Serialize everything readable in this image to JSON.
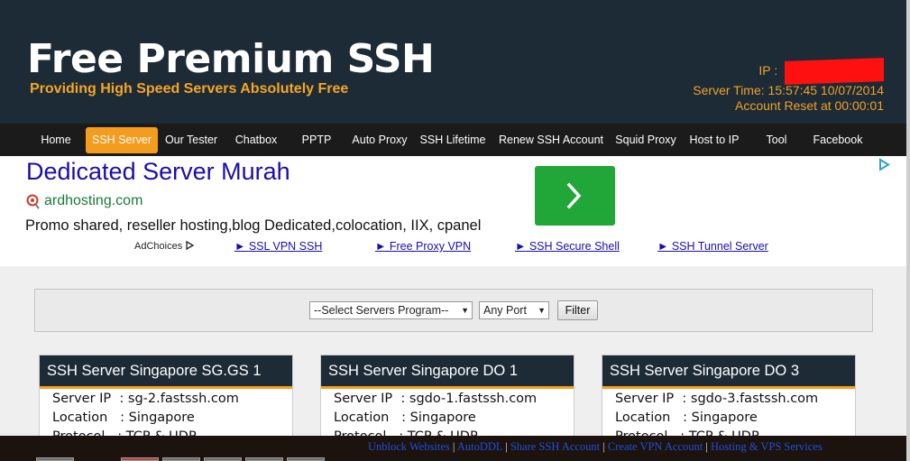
{
  "header": {
    "title": "Free Premium SSH",
    "subtitle": "Providing High Speed Servers Absolutely Free",
    "ip_label": "IP : ",
    "server_time": "Server Time: 15:57:45 10/07/2014",
    "account_reset": "Account Reset at 00:00:01"
  },
  "nav": {
    "active": "SSH Server",
    "items": [
      "Home",
      "SSH Server",
      "Our Tester",
      "Chatbox",
      "PPTP",
      "Auto Proxy",
      "SSH Lifetime",
      "Renew SSH Account",
      "Squid Proxy",
      "Host to IP",
      "Tool",
      "Facebook"
    ]
  },
  "ad": {
    "title": "Dedicated Server Murah",
    "url": "ardhosting.com",
    "description": "Promo shared, reseller hosting,blog Dedicated,colocation, IIX, cpanel",
    "adchoices": "AdChoices",
    "links": [
      "► SSL VPN SSH",
      "► Free Proxy VPN",
      "► SSH Secure Shell",
      "► SSH Tunnel Server"
    ],
    "button_color": "#21a638"
  },
  "filter": {
    "program_select": "--Select Servers Program--",
    "port_select": "Any Port",
    "button": "Filter"
  },
  "servers": [
    {
      "title": "SSH Server Singapore SG.GS 1",
      "ip_label": "Server IP  :",
      "ip": "sg-2.fastssh.com",
      "location_label": "Location   :",
      "location": "Singapore",
      "protocol_label": "Protocol   :",
      "protocol": "TCP & UDP"
    },
    {
      "title": "SSH Server Singapore DO 1",
      "ip_label": "Server IP  :",
      "ip": "sgdo-1.fastssh.com",
      "location_label": "Location   :",
      "location": "Singapore",
      "protocol_label": "Protocol   :",
      "protocol": "TCP & UDP"
    },
    {
      "title": "SSH Server Singapore DO 3",
      "ip_label": "Server IP  :",
      "ip": "sgdo-3.fastssh.com",
      "location_label": "Location   :",
      "location": "Singapore",
      "protocol_label": "Protocol   :",
      "protocol": "TCP & UDP"
    }
  ],
  "footer": {
    "links": [
      "Unblock Websites",
      "AutoDDL",
      "Share SSH Account",
      "Create VPN Account",
      "Hosting & VPS Services"
    ],
    "separator": "|"
  },
  "colors": {
    "header_bg": "#1d2b36",
    "accent": "#f39c1d",
    "nav_bg": "#1b1b1b",
    "link": "#1a0dab"
  }
}
